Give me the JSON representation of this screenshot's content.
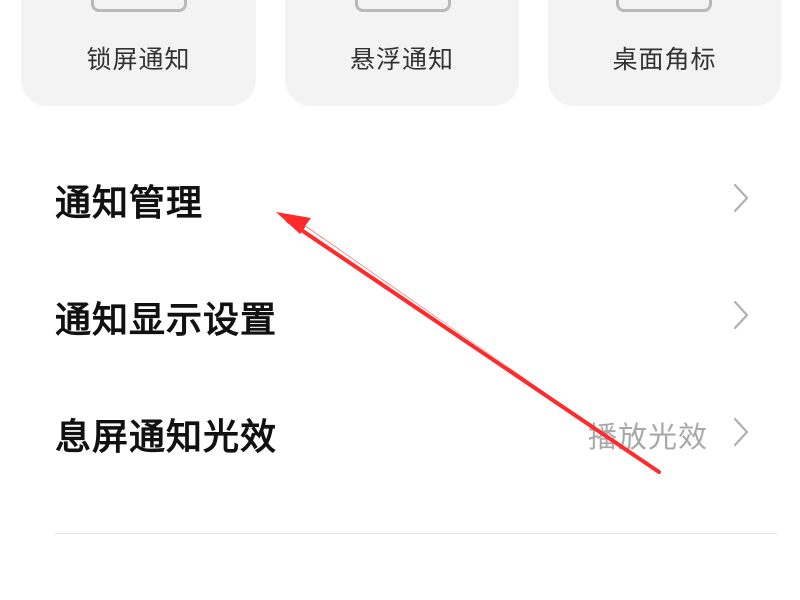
{
  "cards": [
    {
      "label": "锁屏通知"
    },
    {
      "label": "悬浮通知"
    },
    {
      "label": "桌面角标"
    }
  ],
  "settings": [
    {
      "label": "通知管理",
      "value": ""
    },
    {
      "label": "通知显示设置",
      "value": ""
    },
    {
      "label": "息屏通知光效",
      "value": "播放光效"
    }
  ],
  "icons": {
    "chevron": "chevron-right-icon",
    "annotation": "red-arrow"
  },
  "colors": {
    "background": "#ffffff",
    "card": "#f3f3f3",
    "arrow": "#ff2a2a",
    "chevron": "#b0b0b0",
    "value_text": "#a8a8a8"
  }
}
